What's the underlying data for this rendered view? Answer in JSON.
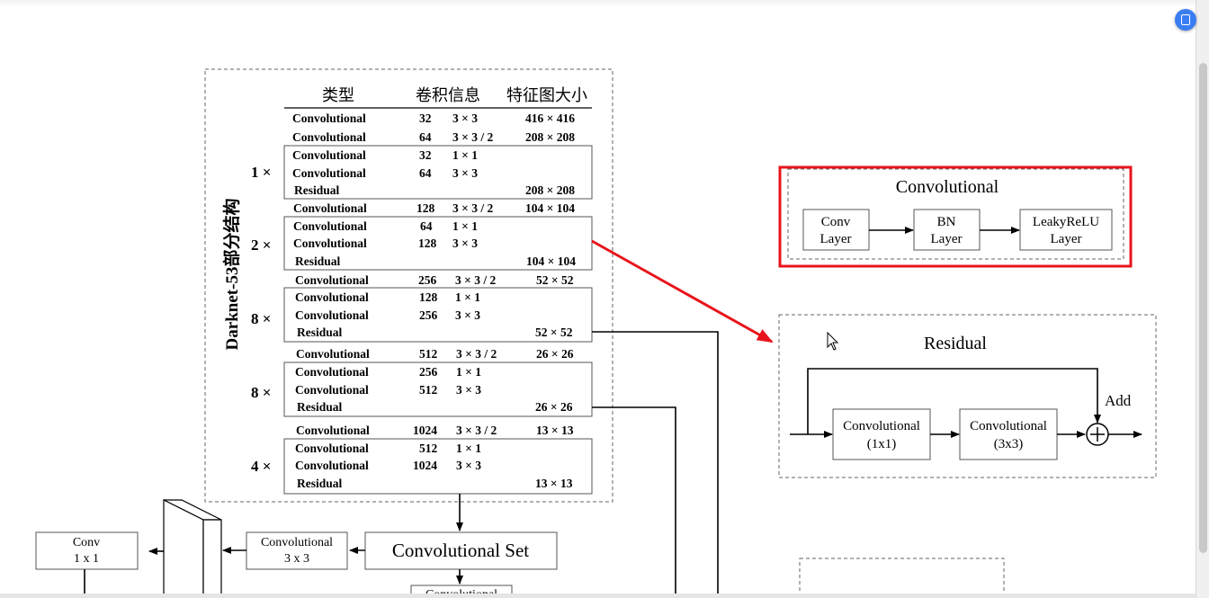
{
  "table": {
    "headers": [
      "类型",
      "卷积信息",
      "特征图大小"
    ],
    "rows": [
      [
        "Convolutional",
        "32",
        "3 × 3",
        "416 × 416"
      ],
      [
        "Convolutional",
        "64",
        "3 × 3 / 2",
        "208 × 208"
      ],
      [
        "Convolutional",
        "32",
        "1 × 1",
        ""
      ],
      [
        "Convolutional",
        "64",
        "3 × 3",
        ""
      ],
      [
        "Residual",
        "",
        "",
        "208 × 208"
      ],
      [
        "Convolutional",
        "128",
        "3 × 3 / 2",
        "104 × 104"
      ],
      [
        "Convolutional",
        "64",
        "1 × 1",
        ""
      ],
      [
        "Convolutional",
        "128",
        "3 × 3",
        ""
      ],
      [
        "Residual",
        "",
        "",
        "104 × 104"
      ],
      [
        "Convolutional",
        "256",
        "3 × 3 / 2",
        "52 × 52"
      ],
      [
        "Convolutional",
        "128",
        "1 × 1",
        ""
      ],
      [
        "Convolutional",
        "256",
        "3 × 3",
        ""
      ],
      [
        "Residual",
        "",
        "",
        "52 × 52"
      ],
      [
        "Convolutional",
        "512",
        "3 × 3 / 2",
        "26 × 26"
      ],
      [
        "Convolutional",
        "256",
        "1 × 1",
        ""
      ],
      [
        "Convolutional",
        "512",
        "3 × 3",
        ""
      ],
      [
        "Residual",
        "",
        "",
        "26 × 26"
      ],
      [
        "Convolutional",
        "1024",
        "3 × 3 / 2",
        "13 × 13"
      ],
      [
        "Convolutional",
        "512",
        "1 × 1",
        ""
      ],
      [
        "Convolutional",
        "1024",
        "3 × 3",
        ""
      ],
      [
        "Residual",
        "",
        "",
        "13 × 13"
      ]
    ],
    "multipliers": [
      "1 ×",
      "2 ×",
      "8 ×",
      "8 ×",
      "4 ×"
    ],
    "side_label": "Darknet-53部分结构"
  },
  "conv_block": {
    "title": "Convolutional",
    "conv_line1": "Conv",
    "conv_line2": "Layer",
    "bn_line1": "BN",
    "bn_line2": "Layer",
    "leaky_line1": "LeakyReLU",
    "leaky_line2": "Layer",
    "highlight_color": "#e8141c"
  },
  "residual_block": {
    "title": "Residual",
    "conv1_line1": "Convolutional",
    "conv1_line2": "(1x1)",
    "conv2_line1": "Convolutional",
    "conv2_line2": "(3x3)",
    "add_label": "Add"
  },
  "bottom": {
    "conv_set": "Convolutional  Set",
    "conv3_line1": "Convolutional",
    "conv3_line2": "3 x 3",
    "conv1_line1": "Conv",
    "conv1_line2": "1 x 1",
    "partial_label": "Convolutional"
  },
  "arrow_color": "#e8141c"
}
